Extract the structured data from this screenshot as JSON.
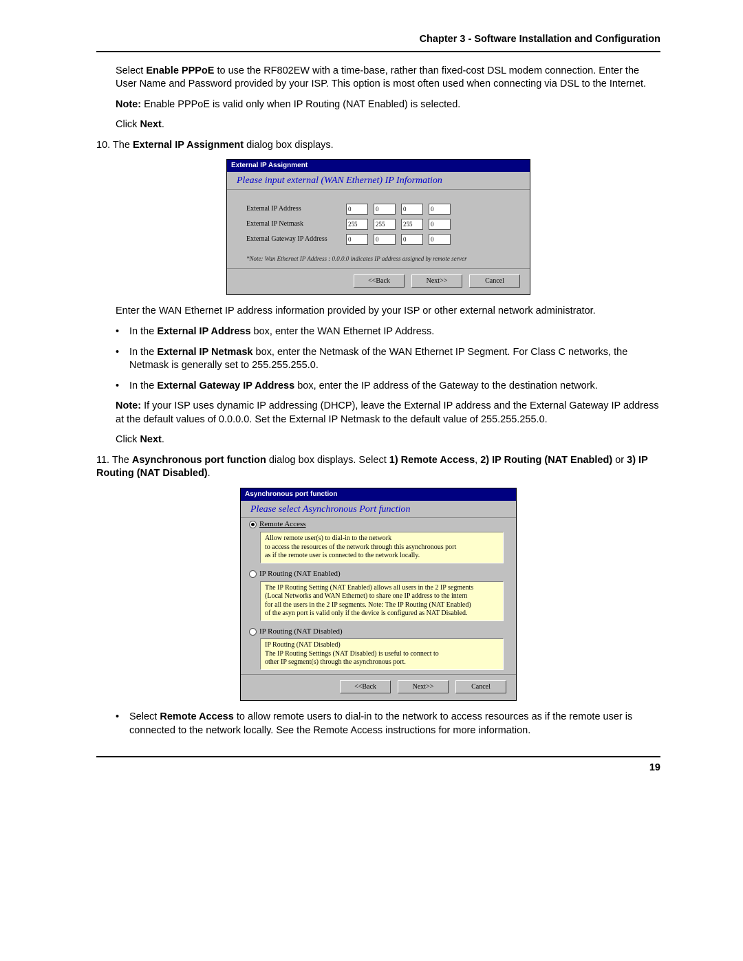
{
  "header": "Chapter 3 - Software Installation and Configuration",
  "page_number": "19",
  "intro": {
    "select_label": "Select ",
    "enable_pppoe": "Enable PPPoE",
    "select_rest": " to use the RF802EW with a time-base, rather than fixed-cost DSL modem connection. Enter the User Name and Password provided by your ISP.  This option is most often used when connecting via DSL to the Internet.",
    "note_label": "Note:",
    "note_text": " Enable PPPoE is valid only when IP Routing (NAT Enabled) is selected.",
    "click": "Click ",
    "next": "Next",
    "period": "."
  },
  "step10": {
    "num": "10. The ",
    "term": "External IP Assignment",
    "rest": " dialog box displays."
  },
  "dlg1": {
    "title": "External IP Assignment",
    "prompt": "Please input external (WAN Ethernet) IP Information",
    "row1": "External IP Address",
    "row2": "External IP Netmask",
    "row3": "External Gateway IP Address",
    "ip0": "0",
    "ip255": "255",
    "note": "*Note: Wan Ethernet IP Address : 0.0.0.0 indicates IP address assigned by remote server",
    "back": "<<Back",
    "next": "Next>>",
    "cancel": "Cancel"
  },
  "after1": {
    "p1": "Enter the WAN Ethernet IP address information provided by your ISP or other external network administrator.",
    "b1_a": "In the ",
    "b1_b": "External IP Address",
    "b1_c": " box, enter the WAN Ethernet IP Address.",
    "b2_a": "In the ",
    "b2_b": "External IP Netmask",
    "b2_c": " box, enter the Netmask of the WAN Ethernet IP Segment.  For Class C networks, the Netmask is generally set to 255.255.255.0.",
    "b3_a": "In the ",
    "b3_b": "External Gateway IP Address",
    "b3_c": " box, enter the IP address of the Gateway to the destination network.",
    "note_label": "Note:",
    "note_text": " If your ISP uses dynamic IP addressing (DHCP), leave the External IP address and the External Gateway IP address at the default values of 0.0.0.0.  Set the External IP Netmask to the default value of 255.255.255.0.",
    "click": "Click ",
    "next": "Next",
    "period": "."
  },
  "step11": {
    "num": "11. The ",
    "term1": "Asynchronous port function",
    "mid": " dialog box displays.  Select ",
    "opt1": "1) Remote Access",
    "comma": ", ",
    "opt2": "2) IP Routing (NAT Enabled)",
    "or": " or ",
    "opt3": "3) IP Routing (NAT Disabled)",
    "period": "."
  },
  "dlg2": {
    "title": "Asynchronous port function",
    "prompt": "Please select Asynchronous Port function",
    "r1": "Remote Access",
    "r1_desc": "Allow remote user(s) to dial-in to the network\nto access the resources of the network through this asynchronous port\nas if the remote user is connected to the network locally.",
    "r2": "IP Routing (NAT Enabled)",
    "r2_desc": "The IP Routing Setting (NAT Enabled) allows all users in the 2 IP segments\n(Local Networks and WAN Ethernet) to share one IP address to the intern\nfor all the users in the 2 IP segments. Note: The IP Routing (NAT Enabled)\nof the asyn port is valid only if the device is configured as NAT Disabled.",
    "r3": "IP Routing (NAT Disabled)",
    "r3_desc": "IP Routing (NAT Disabled)\nThe IP Routing Settings (NAT Disabled) is useful to connect to\nother IP segment(s) through the asynchronous port.",
    "back": "<<Back",
    "next": "Next>>",
    "cancel": "Cancel"
  },
  "after2": {
    "a": "Select ",
    "b": "Remote Access",
    "c": " to allow remote users to dial-in to the network to access resources as if the remote user is connected to the network locally.  See the Remote Access instructions for more information."
  }
}
